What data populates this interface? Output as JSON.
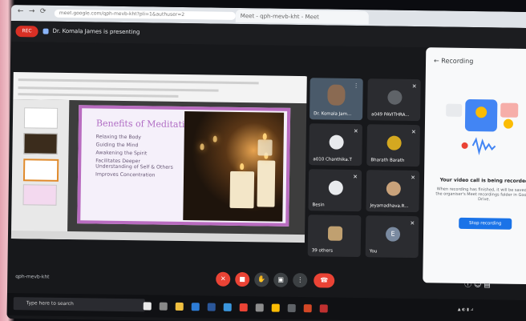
{
  "browser": {
    "url": "meet.google.com/qph-mevb-kht?pli=1&authuser=2",
    "tab_title": "Meet - qph-mevb-kht - Meet"
  },
  "meeting": {
    "rec_badge": "REC",
    "presenting_text": "Dr. Komala James is presenting",
    "code": "qph-mevb-kht"
  },
  "slide": {
    "title": "Benefits of Meditation",
    "bullets": [
      "Relaxing the Body",
      "Guiding the Mind",
      "Awakening the Spirit",
      "Facilitates Deeper Understanding of Self & Others",
      "Improves Concentration"
    ],
    "theme_color": "#b96cc0"
  },
  "participants": [
    {
      "name": "Dr. Komala Jam...",
      "has_video": true
    },
    {
      "name": "a049 PAVITHRA..."
    },
    {
      "name": "a010 Chanthika.T"
    },
    {
      "name": "Bharath Barath"
    },
    {
      "name": "Besin"
    },
    {
      "name": "Jeyamadhava.R..."
    },
    {
      "name": "39 others"
    },
    {
      "name": "You",
      "initial": "E"
    }
  ],
  "recording_panel": {
    "header": "Recording",
    "title": "Your video call is being recorded",
    "description": "When recording has finished, it will be saved in the organiser's Meet recordings folder in Google Drive.",
    "stop_label": "Stop recording"
  },
  "taskbar": {
    "search_placeholder": "Type here to search"
  },
  "colors": {
    "accent": "#1a73e8",
    "danger": "#ea4335"
  }
}
